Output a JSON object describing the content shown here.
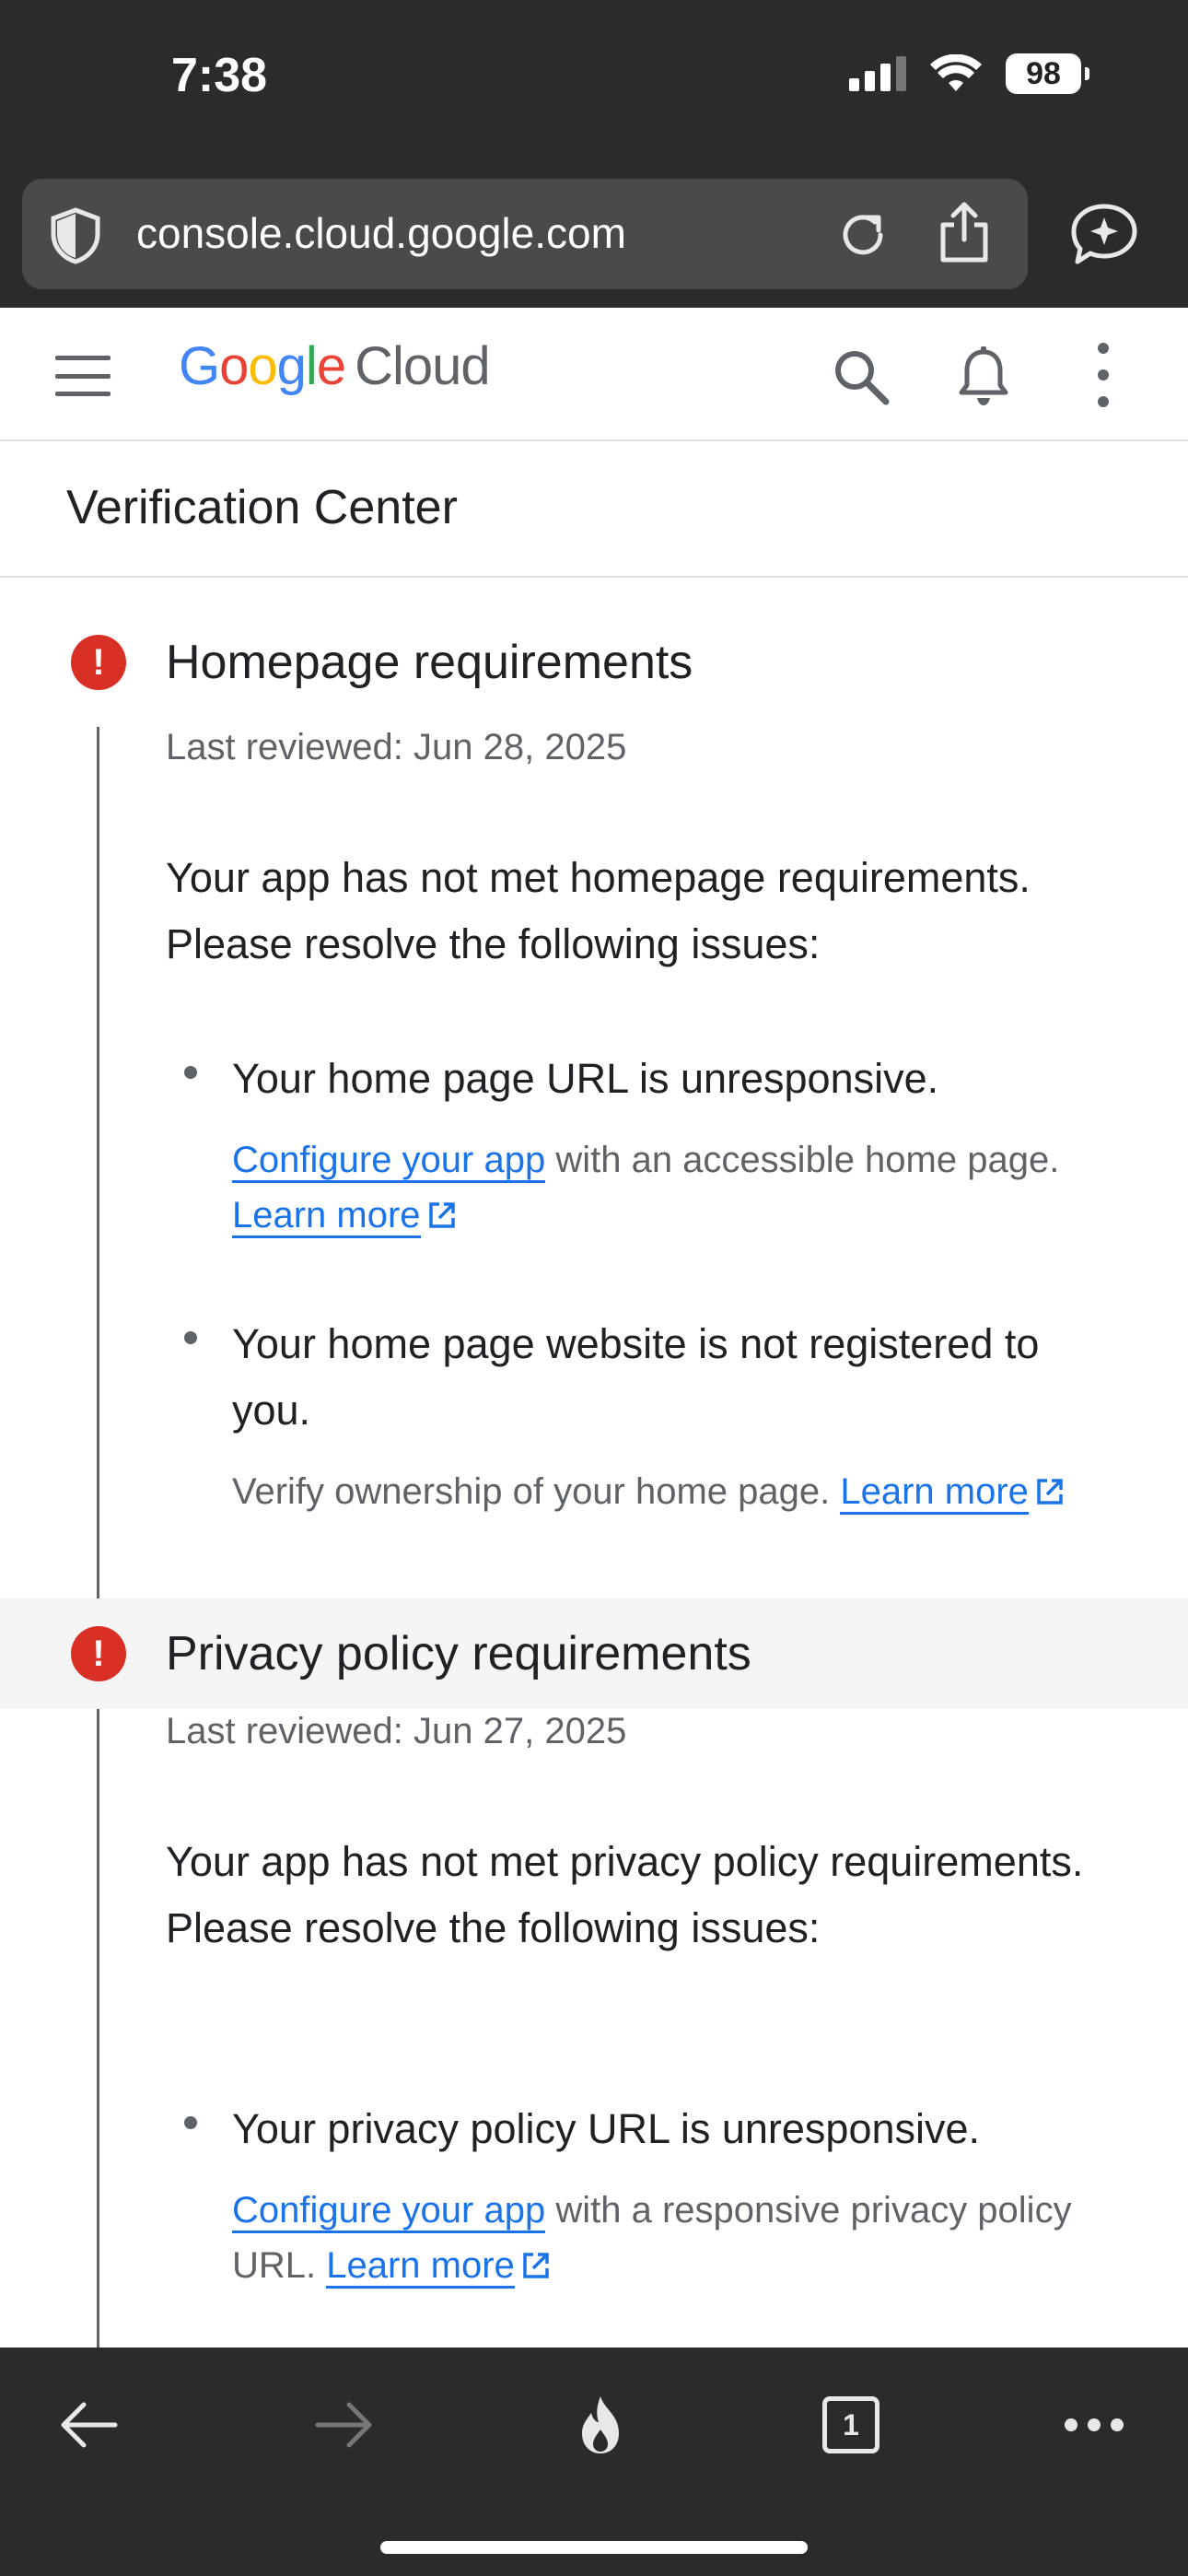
{
  "status_bar": {
    "time": "7:38",
    "battery": "98"
  },
  "browser": {
    "url": "console.cloud.google.com"
  },
  "header": {
    "logo_google": [
      "G",
      "o",
      "o",
      "g",
      "l",
      "e"
    ],
    "logo_product": "Cloud"
  },
  "page": {
    "title": "Verification Center"
  },
  "sections": [
    {
      "title": "Homepage requirements",
      "reviewed": "Last reviewed: Jun 28, 2025",
      "message": "Your app has not met homepage requirements. Please resolve the following issues:",
      "issues": [
        {
          "text": "Your home page URL is unresponsive.",
          "hint_link": "Configure your app",
          "hint_text": " with an accessible home page. ",
          "learn_more": "Learn more"
        },
        {
          "text": "Your home page website is not registered to you.",
          "hint_text": "Verify ownership of your home page. ",
          "learn_more": "Learn more"
        }
      ]
    },
    {
      "title": "Privacy policy requirements",
      "reviewed": "Last reviewed: Jun 27, 2025",
      "message": "Your app has not met privacy policy requirements. Please resolve the following issues:",
      "issues": [
        {
          "text": "Your privacy policy URL is unresponsive.",
          "hint_link": "Configure your app",
          "hint_text": " with a responsive privacy policy URL. ",
          "learn_more": "Learn more"
        }
      ]
    }
  ],
  "toolbar": {
    "tabs_count": "1"
  },
  "colors": {
    "chrome_bg": "#2b2b2b",
    "error": "#d93025",
    "link": "#1a73e8",
    "text_primary": "#202124",
    "text_secondary": "#5f6368"
  },
  "icons": [
    "shield-icon",
    "reload-icon",
    "share-icon",
    "assistant-icon",
    "menu-icon",
    "search-icon",
    "bell-icon",
    "more-vert-icon",
    "error-icon",
    "external-link-icon",
    "back-arrow-icon",
    "forward-arrow-icon",
    "fire-icon",
    "tabs-icon",
    "more-horiz-icon"
  ]
}
